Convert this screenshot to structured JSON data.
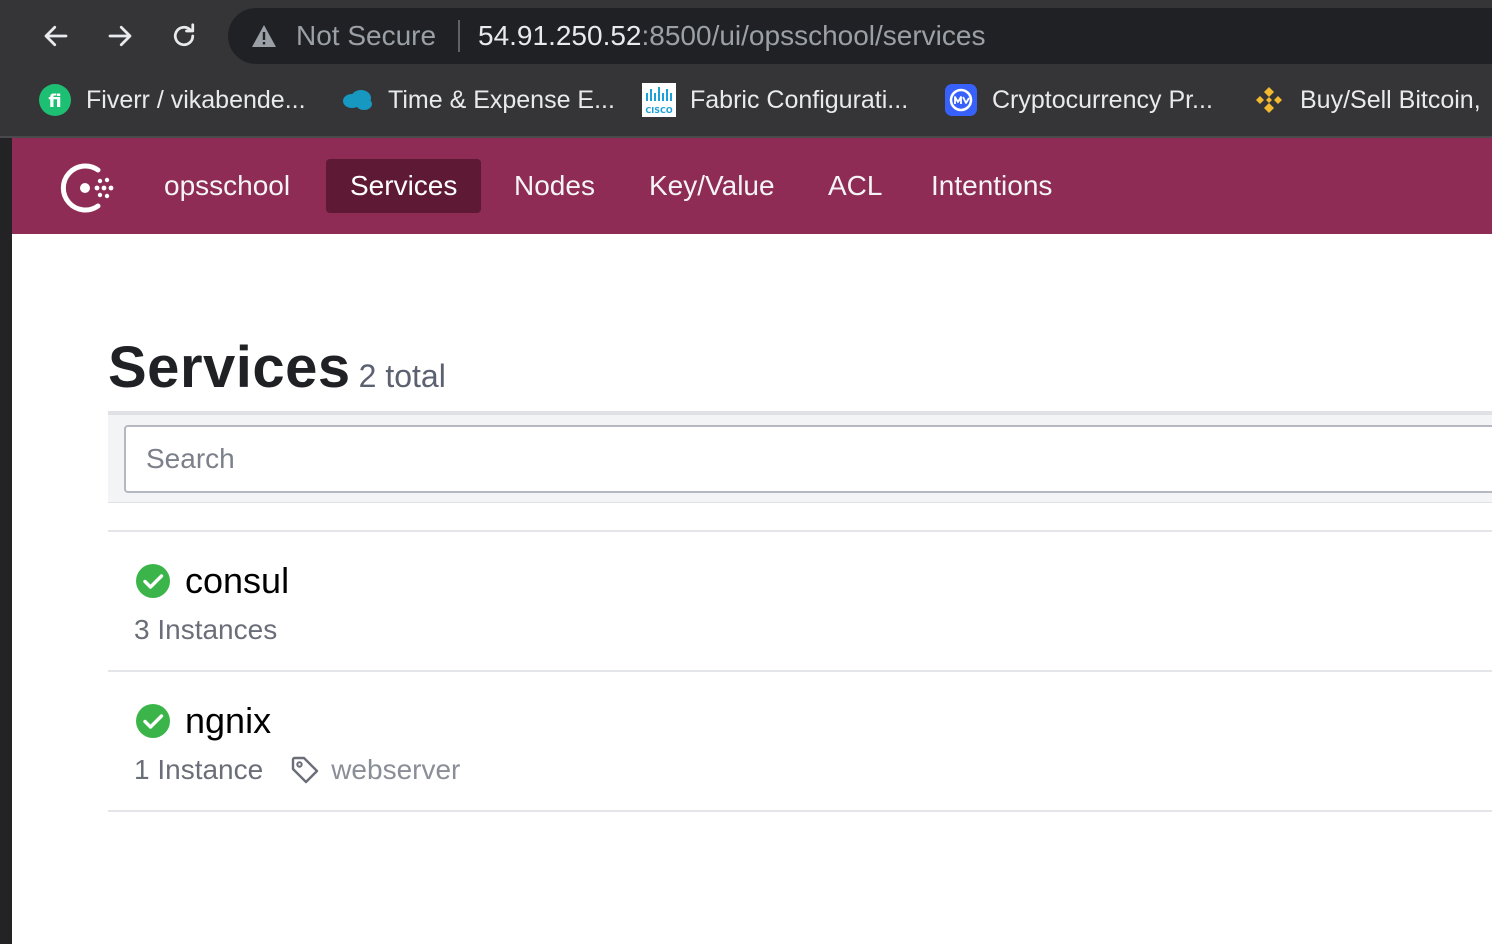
{
  "browser": {
    "not_secure_label": "Not Secure",
    "url_host": "54.91.250.52",
    "url_rest": ":8500/ui/opsschool/services",
    "bookmarks": [
      {
        "label": "Fiverr / vikabende...",
        "icon": "fiverr-icon"
      },
      {
        "label": "Time & Expense E...",
        "icon": "salesforce-cloud-icon"
      },
      {
        "label": "Fabric Configurati...",
        "icon": "cisco-icon"
      },
      {
        "label": "Cryptocurrency Pr...",
        "icon": "coinmarketcap-icon"
      },
      {
        "label": "Buy/Sell Bitcoin,",
        "icon": "binance-icon"
      }
    ]
  },
  "app": {
    "brand_color": "#8e2c55",
    "active_nav_color": "#5e1935",
    "nav": [
      {
        "label": "opsschool",
        "active": false
      },
      {
        "label": "Services",
        "active": true
      },
      {
        "label": "Nodes",
        "active": false
      },
      {
        "label": "Key/Value",
        "active": false
      },
      {
        "label": "ACL",
        "active": false
      },
      {
        "label": "Intentions",
        "active": false
      }
    ]
  },
  "page": {
    "title": "Services",
    "count": "2 total",
    "search_placeholder": "Search"
  },
  "services": [
    {
      "name": "consul",
      "instances": "3 Instances",
      "status": "passing",
      "tags": []
    },
    {
      "name": "ngnix",
      "instances": "1 Instance",
      "status": "passing",
      "tags": [
        "webserver"
      ]
    }
  ],
  "colors": {
    "passing": "#3bb54a"
  }
}
